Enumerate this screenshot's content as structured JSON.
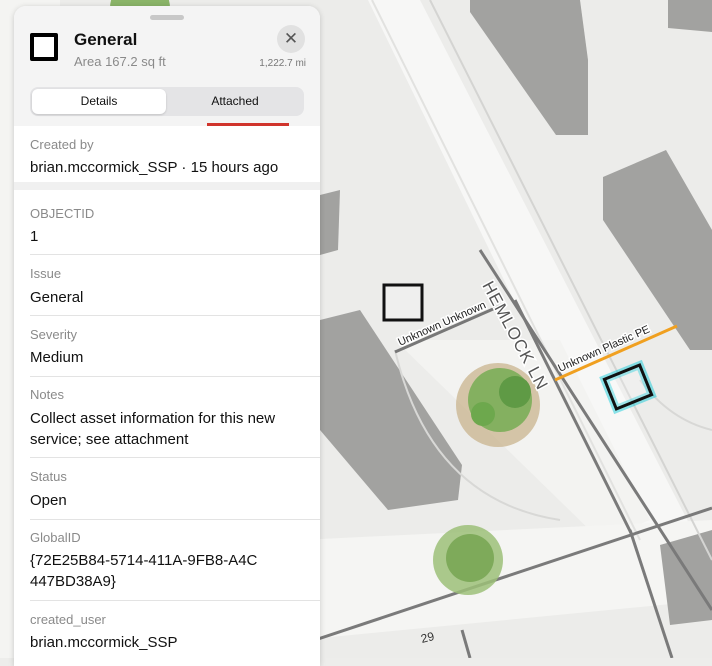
{
  "popup": {
    "title": "General",
    "subtitle": "Area 167.2 sq ft",
    "distance": "1,222.7 mi",
    "close_glyph": "✕",
    "tabs": [
      {
        "label": "Details",
        "active": true
      },
      {
        "label": "Attached",
        "active": false
      }
    ],
    "created": {
      "label": "Created by",
      "value": "brian.mccormick_SSP · 15 hours ago"
    },
    "fields": [
      {
        "label": "OBJECTID",
        "value": "1"
      },
      {
        "label": "Issue",
        "value": "General"
      },
      {
        "label": "Severity",
        "value": "Medium"
      },
      {
        "label": "Notes",
        "value": "Collect asset information for this new service; see attachment"
      },
      {
        "label": "Status",
        "value": "Open"
      },
      {
        "label": "GlobalID",
        "value": "{72E25B84-5714-411A-9FB8-A4C447BD38A9}"
      },
      {
        "label": "created_user",
        "value": "brian.mccormick_SSP"
      }
    ]
  },
  "map": {
    "street_label": "HEMLOCK LN",
    "line_label_gray": "Unknown Unknown",
    "line_label_orange": "Unknown Plastic PE",
    "address_label": "29",
    "colors": {
      "selection": "#00c8d8",
      "service_line": "#f0a020",
      "accent": "#d0342c"
    }
  }
}
